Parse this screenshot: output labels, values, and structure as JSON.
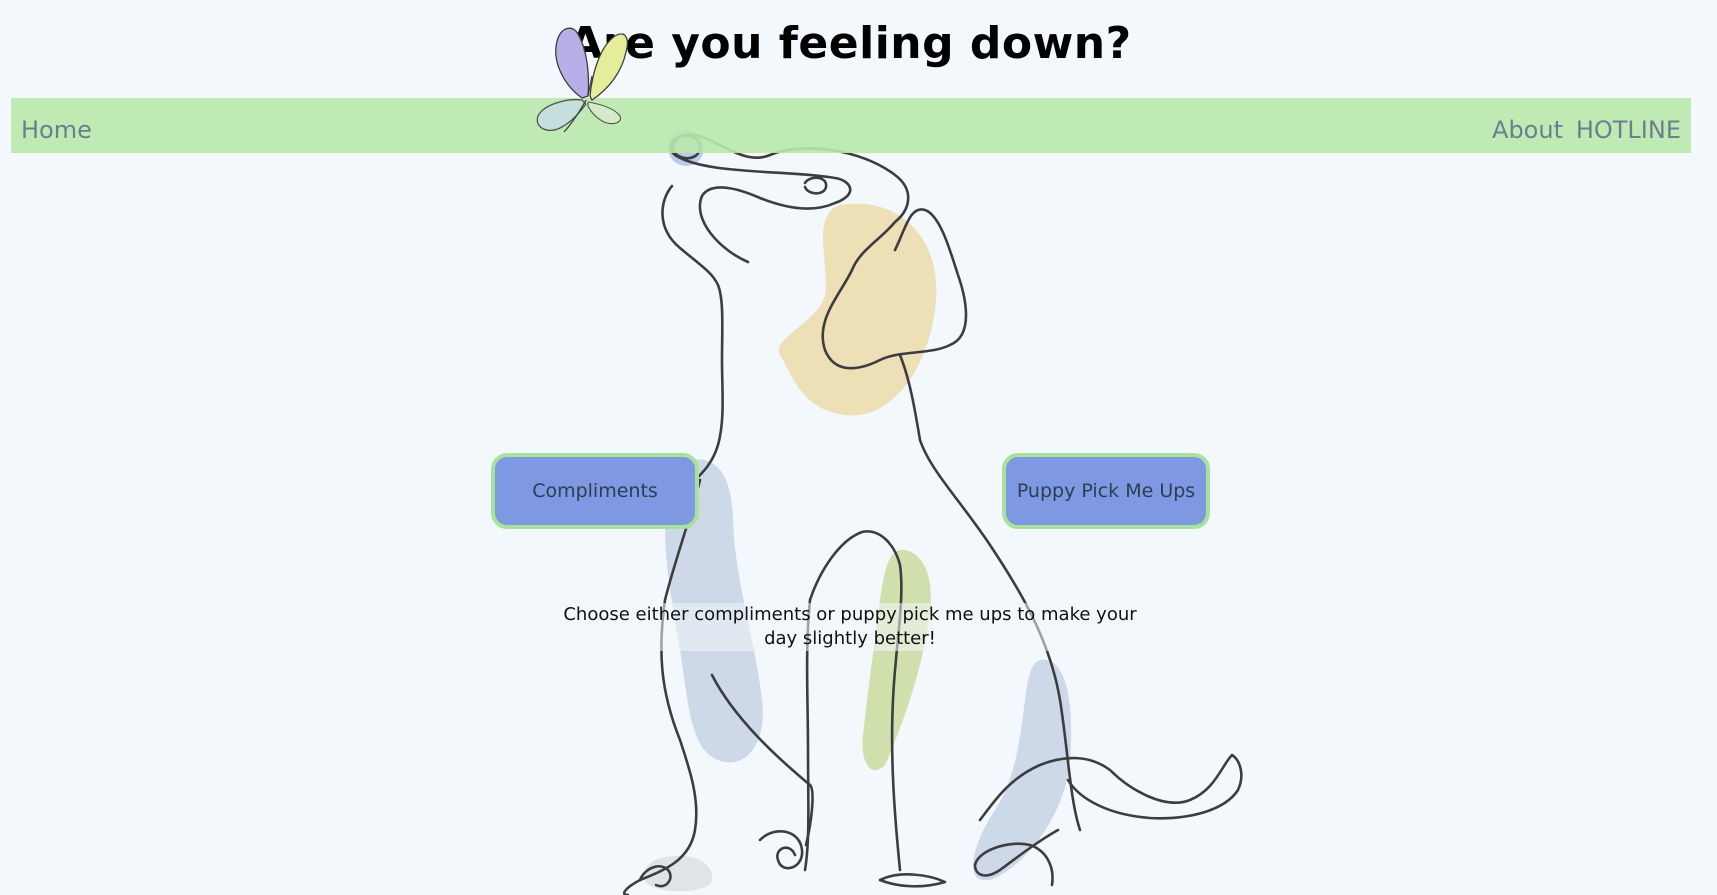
{
  "header": {
    "title": "Are you feeling down?"
  },
  "nav": {
    "home_label": "Home",
    "about_label": "About",
    "hotline_label": "HOTLINE"
  },
  "actions": {
    "compliments_label": "Compliments",
    "puppy_label": "Puppy Pick Me Ups"
  },
  "main": {
    "instruction": "Choose either compliments or puppy pick me ups to make your day slightly better!"
  },
  "theme": {
    "background": "#f3f8fc",
    "navbar": "#bde9ad",
    "button_fill": "#7f98e2",
    "button_border": "#a9e39b",
    "nav_text": "#6b7f8e"
  },
  "icons": {
    "butterfly": "butterfly-icon",
    "dog": "dog-line-illustration"
  }
}
